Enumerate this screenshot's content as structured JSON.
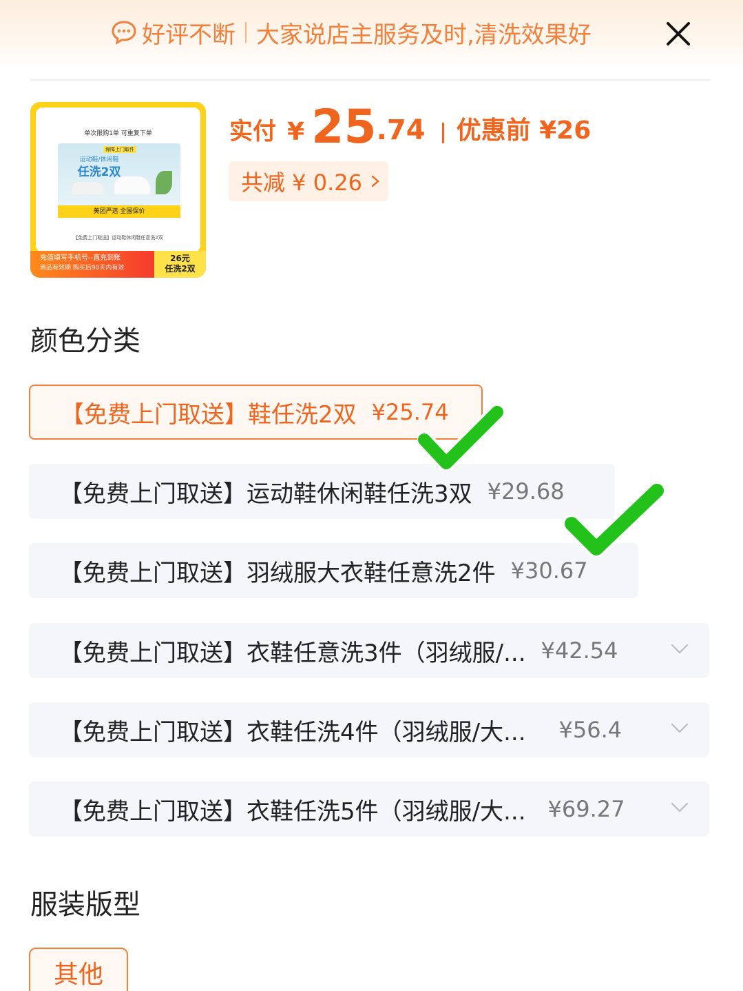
{
  "banner": {
    "review_tag": "好评不断",
    "review_text": "大家说店主服务及时,清洗效果好"
  },
  "product": {
    "image": {
      "limit_text": "单次限购1单  可重复下单",
      "tag": "保障上门取件",
      "sub": "运动鞋/休闲鞋",
      "big": "任洗2双",
      "strip": "美团严选  全国保价",
      "caption": "【免费上门取送】运动鞋休闲鞋任意洗2双",
      "footer_line1": "充值填写手机号--直充到账",
      "footer_line2": "商品有效期  购买后90天内有效",
      "footer_price": "26元",
      "footer_deal": "任洗2双"
    },
    "pay_label": "实付",
    "currency": "¥",
    "pay_int": "25",
    "pay_dec": ".74",
    "before_label": "优惠前 ¥26",
    "discount_label": "共减 ¥ 0.26"
  },
  "sections": {
    "color": "颜色分类",
    "style": "服装版型"
  },
  "options": [
    {
      "name": "【免费上门取送】鞋任洗2双",
      "price": "¥25.74",
      "selected": true
    },
    {
      "name": "【免费上门取送】运动鞋休闲鞋任洗3双",
      "price": "¥29.68"
    },
    {
      "name": "【免费上门取送】羽绒服大衣鞋任意洗2件",
      "price": "¥30.67"
    },
    {
      "name": "【免费上门取送】衣鞋任意洗3件（羽绒服/...",
      "price": "¥42.54"
    },
    {
      "name": "【免费上门取送】衣鞋任洗4件（羽绒服/大...",
      "price": "¥56.4"
    },
    {
      "name": "【免费上门取送】衣鞋任洗5件（羽绒服/大...",
      "price": "¥69.27"
    }
  ],
  "style_option": "其他",
  "colors": {
    "accent": "#f0651e",
    "check": "#22c21a"
  }
}
